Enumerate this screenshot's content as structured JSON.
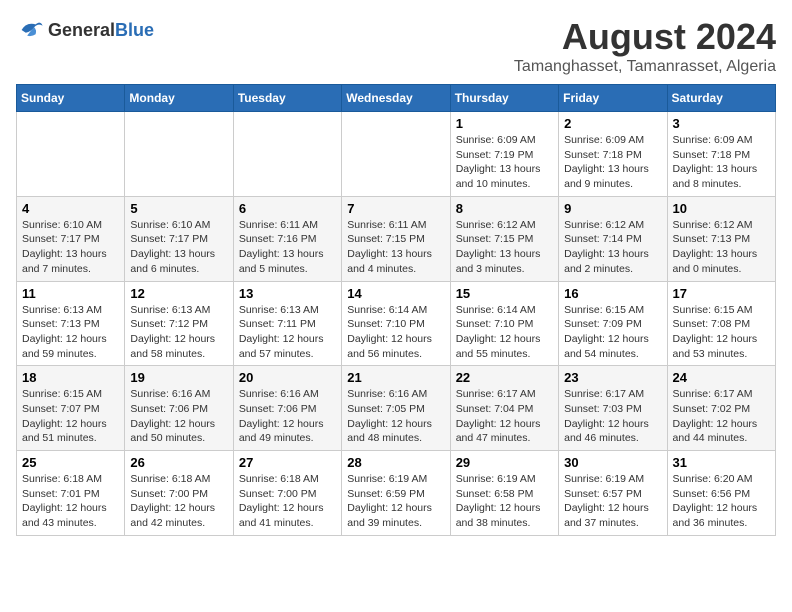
{
  "header": {
    "logo_general": "General",
    "logo_blue": "Blue",
    "main_title": "August 2024",
    "subtitle": "Tamanghasset, Tamanrasset, Algeria"
  },
  "days_of_week": [
    "Sunday",
    "Monday",
    "Tuesday",
    "Wednesday",
    "Thursday",
    "Friday",
    "Saturday"
  ],
  "weeks": [
    [
      {
        "day": "",
        "info": ""
      },
      {
        "day": "",
        "info": ""
      },
      {
        "day": "",
        "info": ""
      },
      {
        "day": "",
        "info": ""
      },
      {
        "day": "1",
        "info": "Sunrise: 6:09 AM\nSunset: 7:19 PM\nDaylight: 13 hours and 10 minutes."
      },
      {
        "day": "2",
        "info": "Sunrise: 6:09 AM\nSunset: 7:18 PM\nDaylight: 13 hours and 9 minutes."
      },
      {
        "day": "3",
        "info": "Sunrise: 6:09 AM\nSunset: 7:18 PM\nDaylight: 13 hours and 8 minutes."
      }
    ],
    [
      {
        "day": "4",
        "info": "Sunrise: 6:10 AM\nSunset: 7:17 PM\nDaylight: 13 hours and 7 minutes."
      },
      {
        "day": "5",
        "info": "Sunrise: 6:10 AM\nSunset: 7:17 PM\nDaylight: 13 hours and 6 minutes."
      },
      {
        "day": "6",
        "info": "Sunrise: 6:11 AM\nSunset: 7:16 PM\nDaylight: 13 hours and 5 minutes."
      },
      {
        "day": "7",
        "info": "Sunrise: 6:11 AM\nSunset: 7:15 PM\nDaylight: 13 hours and 4 minutes."
      },
      {
        "day": "8",
        "info": "Sunrise: 6:12 AM\nSunset: 7:15 PM\nDaylight: 13 hours and 3 minutes."
      },
      {
        "day": "9",
        "info": "Sunrise: 6:12 AM\nSunset: 7:14 PM\nDaylight: 13 hours and 2 minutes."
      },
      {
        "day": "10",
        "info": "Sunrise: 6:12 AM\nSunset: 7:13 PM\nDaylight: 13 hours and 0 minutes."
      }
    ],
    [
      {
        "day": "11",
        "info": "Sunrise: 6:13 AM\nSunset: 7:13 PM\nDaylight: 12 hours and 59 minutes."
      },
      {
        "day": "12",
        "info": "Sunrise: 6:13 AM\nSunset: 7:12 PM\nDaylight: 12 hours and 58 minutes."
      },
      {
        "day": "13",
        "info": "Sunrise: 6:13 AM\nSunset: 7:11 PM\nDaylight: 12 hours and 57 minutes."
      },
      {
        "day": "14",
        "info": "Sunrise: 6:14 AM\nSunset: 7:10 PM\nDaylight: 12 hours and 56 minutes."
      },
      {
        "day": "15",
        "info": "Sunrise: 6:14 AM\nSunset: 7:10 PM\nDaylight: 12 hours and 55 minutes."
      },
      {
        "day": "16",
        "info": "Sunrise: 6:15 AM\nSunset: 7:09 PM\nDaylight: 12 hours and 54 minutes."
      },
      {
        "day": "17",
        "info": "Sunrise: 6:15 AM\nSunset: 7:08 PM\nDaylight: 12 hours and 53 minutes."
      }
    ],
    [
      {
        "day": "18",
        "info": "Sunrise: 6:15 AM\nSunset: 7:07 PM\nDaylight: 12 hours and 51 minutes."
      },
      {
        "day": "19",
        "info": "Sunrise: 6:16 AM\nSunset: 7:06 PM\nDaylight: 12 hours and 50 minutes."
      },
      {
        "day": "20",
        "info": "Sunrise: 6:16 AM\nSunset: 7:06 PM\nDaylight: 12 hours and 49 minutes."
      },
      {
        "day": "21",
        "info": "Sunrise: 6:16 AM\nSunset: 7:05 PM\nDaylight: 12 hours and 48 minutes."
      },
      {
        "day": "22",
        "info": "Sunrise: 6:17 AM\nSunset: 7:04 PM\nDaylight: 12 hours and 47 minutes."
      },
      {
        "day": "23",
        "info": "Sunrise: 6:17 AM\nSunset: 7:03 PM\nDaylight: 12 hours and 46 minutes."
      },
      {
        "day": "24",
        "info": "Sunrise: 6:17 AM\nSunset: 7:02 PM\nDaylight: 12 hours and 44 minutes."
      }
    ],
    [
      {
        "day": "25",
        "info": "Sunrise: 6:18 AM\nSunset: 7:01 PM\nDaylight: 12 hours and 43 minutes."
      },
      {
        "day": "26",
        "info": "Sunrise: 6:18 AM\nSunset: 7:00 PM\nDaylight: 12 hours and 42 minutes."
      },
      {
        "day": "27",
        "info": "Sunrise: 6:18 AM\nSunset: 7:00 PM\nDaylight: 12 hours and 41 minutes."
      },
      {
        "day": "28",
        "info": "Sunrise: 6:19 AM\nSunset: 6:59 PM\nDaylight: 12 hours and 39 minutes."
      },
      {
        "day": "29",
        "info": "Sunrise: 6:19 AM\nSunset: 6:58 PM\nDaylight: 12 hours and 38 minutes."
      },
      {
        "day": "30",
        "info": "Sunrise: 6:19 AM\nSunset: 6:57 PM\nDaylight: 12 hours and 37 minutes."
      },
      {
        "day": "31",
        "info": "Sunrise: 6:20 AM\nSunset: 6:56 PM\nDaylight: 12 hours and 36 minutes."
      }
    ]
  ]
}
